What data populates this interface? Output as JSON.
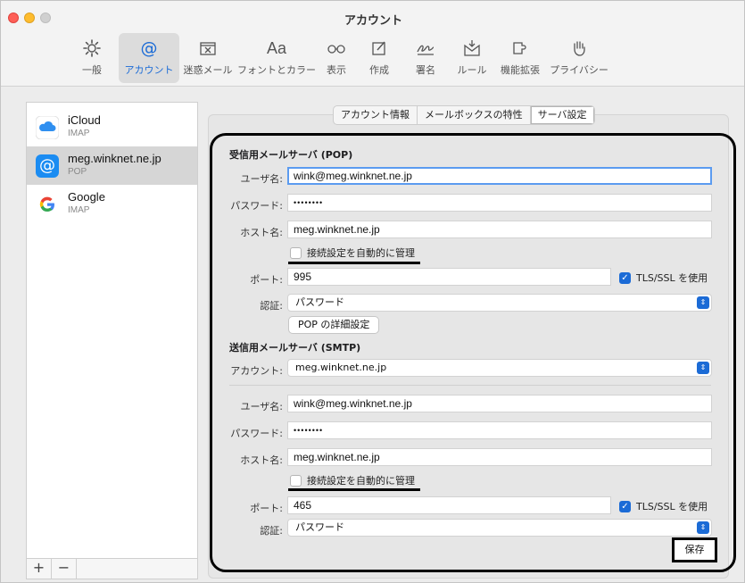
{
  "window": {
    "title": "アカウント"
  },
  "toolbar": {
    "items": [
      {
        "label": "一般",
        "icon": "gear-icon"
      },
      {
        "label": "アカウント",
        "icon": "at-icon",
        "active": true
      },
      {
        "label": "迷惑メール",
        "icon": "junk-tray-icon"
      },
      {
        "label": "フォントとカラー",
        "icon": "font-icon",
        "glyph": "Aa"
      },
      {
        "label": "表示",
        "icon": "glasses-icon"
      },
      {
        "label": "作成",
        "icon": "compose-icon"
      },
      {
        "label": "署名",
        "icon": "signature-icon"
      },
      {
        "label": "ルール",
        "icon": "rules-icon"
      },
      {
        "label": "機能拡張",
        "icon": "extensions-icon"
      },
      {
        "label": "プライバシー",
        "icon": "hand-icon"
      }
    ]
  },
  "sidebar": {
    "accounts": [
      {
        "name": "iCloud",
        "type": "IMAP",
        "icon": "icloud-icon"
      },
      {
        "name": "meg.winknet.ne.jp",
        "type": "POP",
        "icon": "at-icon",
        "selected": true
      },
      {
        "name": "Google",
        "type": "IMAP",
        "icon": "google-icon"
      }
    ],
    "add_label": "+",
    "remove_label": "−"
  },
  "tabs": {
    "items": [
      "アカウント情報",
      "メールボックスの特性",
      "サーバ設定"
    ],
    "active": "サーバ設定"
  },
  "incoming": {
    "title": "受信用メールサーバ (POP)",
    "user_label": "ユーザ名:",
    "user_value": "wink@meg.winknet.ne.jp",
    "password_label": "パスワード:",
    "password_value": "••••••••",
    "host_label": "ホスト名:",
    "host_value": "meg.winknet.ne.jp",
    "auto_manage_label": "接続設定を自動的に管理",
    "port_label": "ポート:",
    "port_value": "995",
    "tls_label": "TLS/SSL を使用",
    "auth_label": "認証:",
    "auth_value": "パスワード",
    "advanced_button": "POP の詳細設定"
  },
  "outgoing": {
    "title": "送信用メールサーバ (SMTP)",
    "account_label": "アカウント:",
    "account_value": "meg.winknet.ne.jp",
    "user_label": "ユーザ名:",
    "user_value": "wink@meg.winknet.ne.jp",
    "password_label": "パスワード:",
    "password_value": "••••••••",
    "host_label": "ホスト名:",
    "host_value": "meg.winknet.ne.jp",
    "auto_manage_label": "接続設定を自動的に管理",
    "port_label": "ポート:",
    "port_value": "465",
    "tls_label": "TLS/SSL を使用",
    "auth_label": "認証:",
    "auth_value": "パスワード"
  },
  "save_button": "保存",
  "colors": {
    "accent": "#1b6bd6",
    "highlight_frame": "#000000"
  }
}
